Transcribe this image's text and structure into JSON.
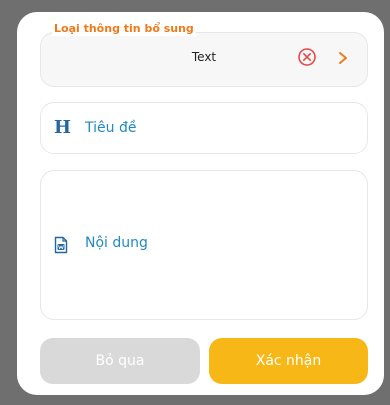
{
  "dialog": {
    "type_label": "Loại thông tin bổ sung",
    "type_value": "Text",
    "title_placeholder": "Tiêu đề",
    "content_placeholder": "Nội dung",
    "skip_label": "Bỏ qua",
    "confirm_label": "Xác nhận"
  },
  "icons": {
    "clear": "close-circle-icon",
    "chevron": "chevron-right-icon",
    "title": "heading-icon",
    "content": "document-icon"
  },
  "colors": {
    "accent_orange": "#ef7a1a",
    "link_blue": "#2189c5",
    "confirm_yellow": "#f7b717",
    "disabled_gray": "#d9d9d9",
    "clear_red": "#e5484d"
  }
}
